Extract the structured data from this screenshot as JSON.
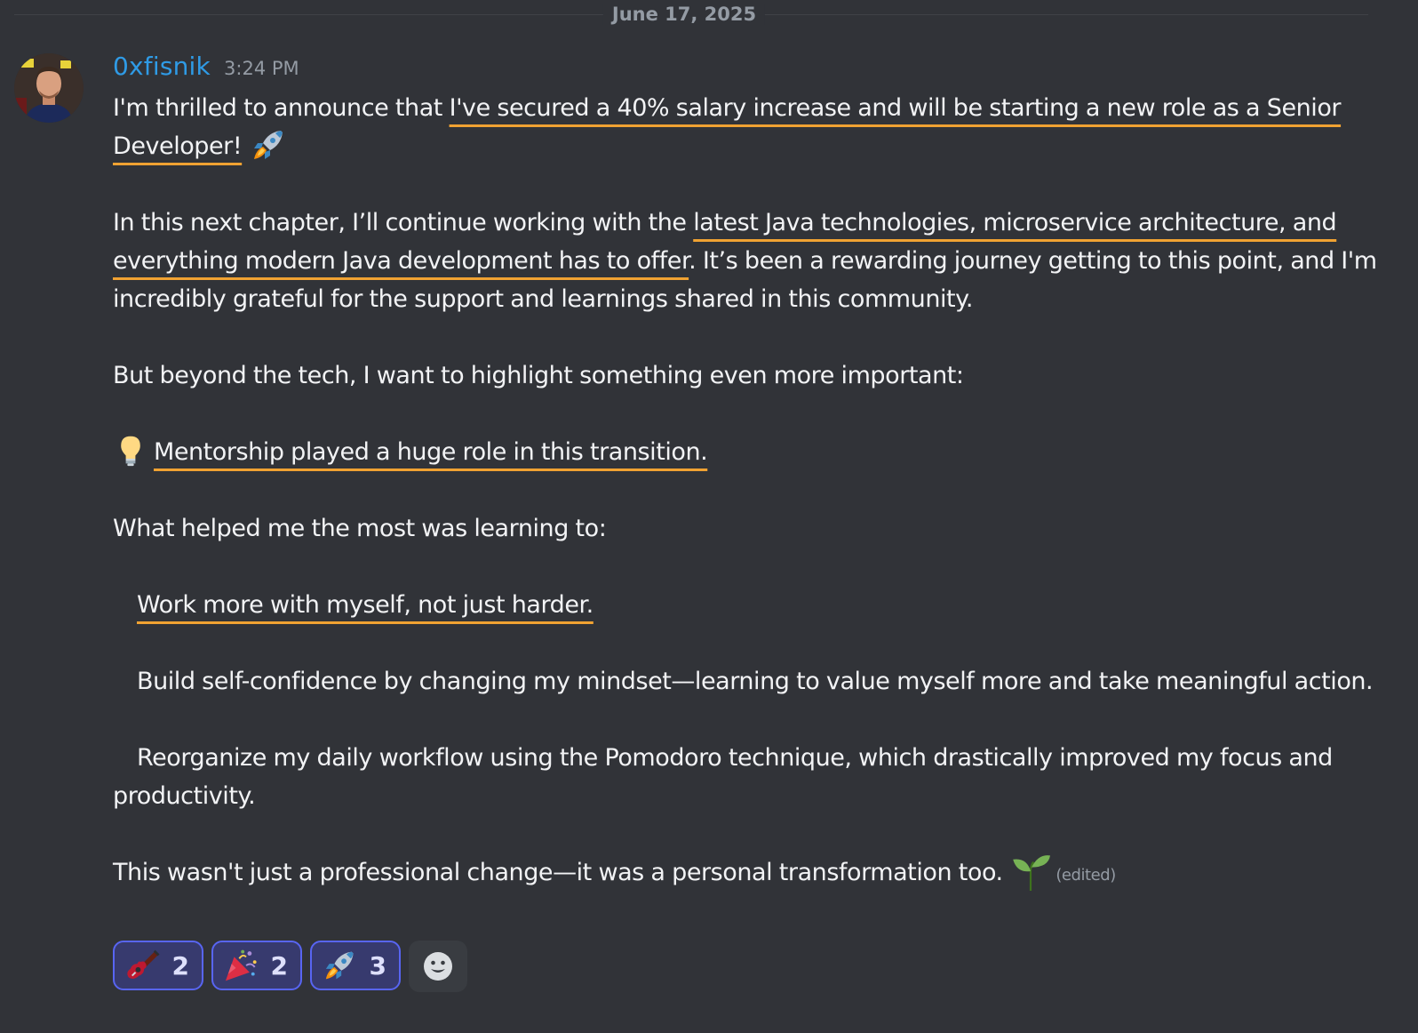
{
  "date_divider": "June 17, 2025",
  "message": {
    "username": "0xfisnik",
    "timestamp": "3:24 PM",
    "paragraphs": {
      "p1_pre": "I'm thrilled to announce that ",
      "p1_hl": "I've secured a 40% salary increase and will be starting a new role as a Senior Developer!",
      "p2_pre": "In this next chapter, I’ll continue working with the ",
      "p2_hl": "latest Java technologies, microservice architecture, and everything modern Java development has to offer",
      "p2_post": ". It’s been a rewarding journey getting to this point, and I'm incredibly grateful for the support and learnings shared in this community.",
      "p3": "But beyond the tech, I want to highlight something even more important:",
      "p4_hl": "Mentorship played a huge role in this transition.",
      "p5": "What helped me the most was learning to:",
      "p6_hl": "Work more with myself, not just harder.",
      "p7": "Build self-confidence by changing my mindset—learning to value myself more and take meaningful action.",
      "p8": "Reorganize my daily workflow using the Pomodoro technique, which drastically improved my focus and productivity.",
      "p9": "This wasn't just a professional change—it was a personal transformation too."
    },
    "edited_label": "(edited)",
    "emojis": {
      "p1": "rocket-emoji",
      "p4": "lightbulb-emoji",
      "p9": "seedling-emoji"
    }
  },
  "reactions": [
    {
      "emoji": "guitar-emoji",
      "count": "2"
    },
    {
      "emoji": "party-popper-emoji",
      "count": "2"
    },
    {
      "emoji": "rocket-emoji",
      "count": "3"
    }
  ],
  "add_reaction_icon": "smiley-face-icon",
  "colors": {
    "background": "#313338",
    "username": "#2f9be6",
    "underline_highlight": "#f0a232",
    "reaction_border": "#5865f2"
  }
}
